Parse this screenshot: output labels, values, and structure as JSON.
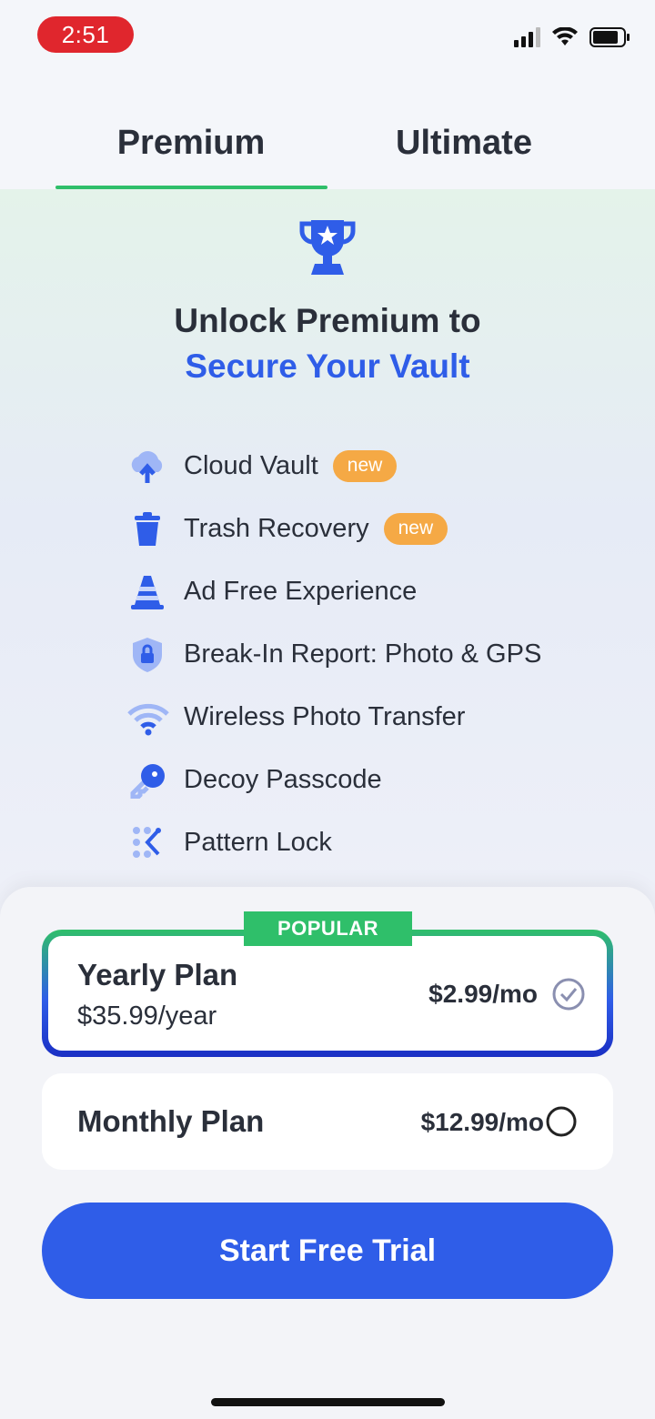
{
  "status_bar": {
    "time": "2:51"
  },
  "tabs": [
    {
      "label": "Premium",
      "active": true
    },
    {
      "label": "Ultimate",
      "active": false
    }
  ],
  "hero": {
    "headline_line1": "Unlock Premium to",
    "headline_line2": "Secure Your Vault"
  },
  "features": [
    {
      "label": "Cloud Vault",
      "badge": "new",
      "icon": "cloud-upload-icon"
    },
    {
      "label": "Trash Recovery",
      "badge": "new",
      "icon": "trash-icon"
    },
    {
      "label": "Ad Free Experience",
      "icon": "traffic-cone-icon"
    },
    {
      "label": "Break-In Report: Photo & GPS",
      "icon": "shield-lock-icon"
    },
    {
      "label": "Wireless Photo Transfer",
      "icon": "wifi-icon"
    },
    {
      "label": "Decoy Passcode",
      "icon": "key-icon"
    },
    {
      "label": "Pattern Lock",
      "icon": "pattern-grid-icon"
    }
  ],
  "plans": {
    "popular_label": "POPULAR",
    "yearly": {
      "name": "Yearly Plan",
      "sub": "$35.99/year",
      "price": "$2.99/mo",
      "selected": true
    },
    "monthly": {
      "name": "Monthly Plan",
      "price": "$12.99/mo",
      "selected": false
    }
  },
  "cta": {
    "label": "Start Free Trial"
  },
  "colors": {
    "accent": "#2f5de8",
    "green": "#2fbf6a",
    "badge": "#f5a945"
  }
}
